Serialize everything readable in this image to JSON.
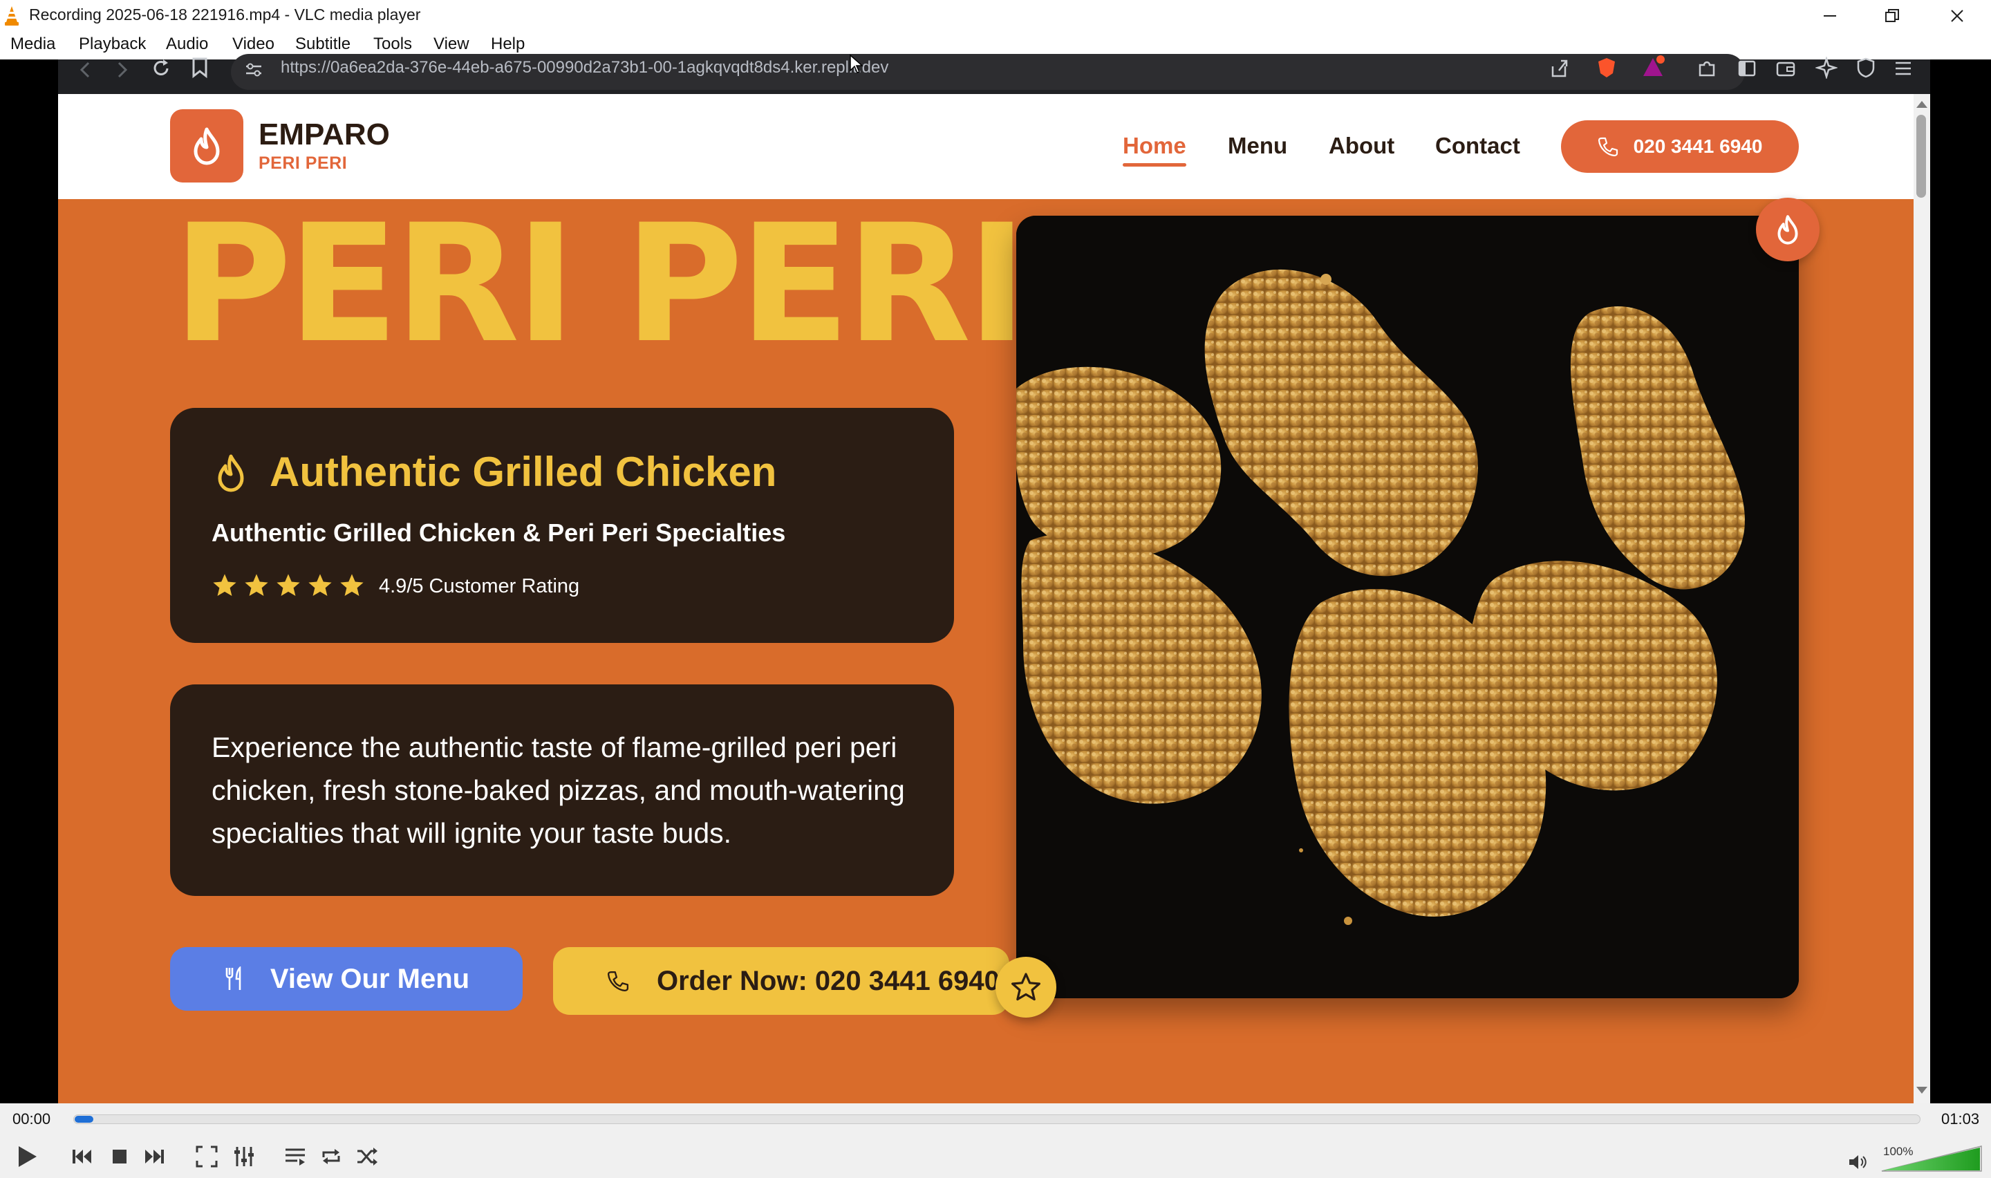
{
  "window": {
    "title": "Recording 2025-06-18 221916.mp4 - VLC media player"
  },
  "menubar": [
    "Media",
    "Playback",
    "Audio",
    "Video",
    "Subtitle",
    "Tools",
    "View",
    "Help"
  ],
  "browser": {
    "url": "https://0a6ea2da-376e-44eb-a675-00990d2a73b1-00-1agkqvqdt8ds4.ker.replit.dev"
  },
  "site": {
    "brand": "EMPARO",
    "brand_sub": "PERI PERI",
    "nav": [
      "Home",
      "Menu",
      "About",
      "Contact"
    ],
    "phone_button": "020 3441 6940",
    "hero_title": "PERI PERI",
    "card1": {
      "title": "Authentic Grilled Chicken",
      "subtitle": "Authentic Grilled Chicken & Peri Peri Specialties",
      "rating_text": "4.9/5 Customer Rating",
      "stars": 5
    },
    "card2": {
      "text": "Experience the authentic taste of flame-grilled peri peri chicken, fresh stone-baked pizzas, and mouth-watering specialties that will ignite your taste buds."
    },
    "buttons": {
      "menu": "View Our Menu",
      "order": "Order Now: 020 3441 6940"
    },
    "colors": {
      "primary": "#e2663a",
      "hero_bg": "#d96c2b",
      "accent_yellow": "#f1c23f",
      "dark_card": "#2b1d14",
      "menu_button": "#5b7ee5"
    }
  },
  "player": {
    "elapsed": "00:00",
    "duration": "01:03",
    "progress": 0.01,
    "volume": "100%"
  }
}
